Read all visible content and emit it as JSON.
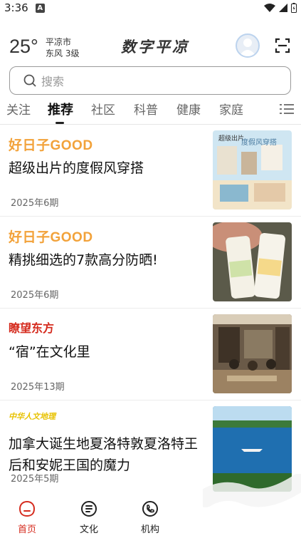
{
  "status_bar": {
    "time": "3:36",
    "app_icon": "A"
  },
  "header": {
    "temperature": "25°",
    "city": "平凉市",
    "wind": "东风  3级",
    "app_title": "数字平凉"
  },
  "search": {
    "placeholder": "搜索"
  },
  "tabs": [
    {
      "label": "关注"
    },
    {
      "label": "推荐",
      "active": true
    },
    {
      "label": "社区"
    },
    {
      "label": "科普"
    },
    {
      "label": "健康"
    },
    {
      "label": "家庭"
    }
  ],
  "feed": [
    {
      "source": "好日子GOOD",
      "title": "超级出片的度假风穿搭",
      "date": "2025年6期",
      "thumb_alt": "超级出片 度假风穿搭"
    },
    {
      "source": "好日子GOOD",
      "title": "精挑细选的7款高分防晒!",
      "date": "2025年6期",
      "thumb_alt": "防晒霜"
    },
    {
      "source": "瞭望东方",
      "title": "“宿”在文化里",
      "date": "2025年13期",
      "thumb_alt": "茶室"
    },
    {
      "source": "中华人文地理",
      "title": "加拿大诞生地夏洛特敦夏洛特王后和安妮王国的魔力",
      "date": "2025年5期",
      "thumb_alt": "湖景"
    }
  ],
  "bottom_nav": [
    {
      "label": "首页",
      "active": true,
      "icon": "home-icon"
    },
    {
      "label": "文化",
      "icon": "book-icon"
    },
    {
      "label": "机构",
      "icon": "phone-icon"
    }
  ],
  "colors": {
    "accent_red": "#d52b1e",
    "good_orange": "#f2a23a"
  }
}
